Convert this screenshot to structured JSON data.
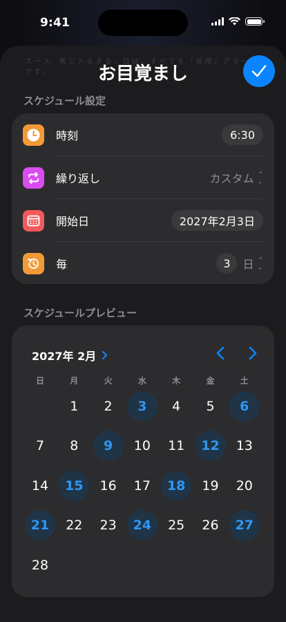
{
  "status_bar": {
    "time": "9:41"
  },
  "sheet": {
    "title": "お目覚まし",
    "ghost_text": "ス  ー  ス、  者  三  ト  る  オ  る  、  日  は  、  す  べ  て  を  「  返  用  」  ア  ラ  ー  ム  で  す  。"
  },
  "schedule_settings": {
    "section_label": "スケジュール設定",
    "time": {
      "label": "時刻",
      "value": "6:30",
      "icon": "clock-icon",
      "color": "#f29a38"
    },
    "repeat": {
      "label": "繰り返し",
      "value": "カスタム",
      "icon": "repeat-icon",
      "color": "#d94df0"
    },
    "start_date": {
      "label": "開始日",
      "value": "2027年2月3日",
      "icon": "calendar-icon",
      "color": "#f25a5e"
    },
    "interval": {
      "label": "毎",
      "count": "3",
      "unit": "日",
      "icon": "history-icon",
      "color": "#f29a38"
    }
  },
  "preview": {
    "section_label": "スケジュールプレビュー",
    "month_label": "2027年 2月",
    "weekdays": [
      "日",
      "月",
      "火",
      "水",
      "木",
      "金",
      "土"
    ],
    "days": [
      {
        "n": "1",
        "hl": false
      },
      {
        "n": "2",
        "hl": false
      },
      {
        "n": "3",
        "hl": true
      },
      {
        "n": "4",
        "hl": false
      },
      {
        "n": "5",
        "hl": false
      },
      {
        "n": "6",
        "hl": true
      },
      {
        "n": "7",
        "hl": false
      },
      {
        "n": "8",
        "hl": false
      },
      {
        "n": "9",
        "hl": true
      },
      {
        "n": "10",
        "hl": false
      },
      {
        "n": "11",
        "hl": false
      },
      {
        "n": "12",
        "hl": true
      },
      {
        "n": "13",
        "hl": false
      },
      {
        "n": "14",
        "hl": false
      },
      {
        "n": "15",
        "hl": true
      },
      {
        "n": "16",
        "hl": false
      },
      {
        "n": "17",
        "hl": false
      },
      {
        "n": "18",
        "hl": true
      },
      {
        "n": "19",
        "hl": false
      },
      {
        "n": "20",
        "hl": false
      },
      {
        "n": "21",
        "hl": true
      },
      {
        "n": "22",
        "hl": false
      },
      {
        "n": "23",
        "hl": false
      },
      {
        "n": "24",
        "hl": true
      },
      {
        "n": "25",
        "hl": false
      },
      {
        "n": "26",
        "hl": false
      },
      {
        "n": "27",
        "hl": true
      },
      {
        "n": "28",
        "hl": false
      }
    ],
    "accent": "#0a84ff"
  }
}
